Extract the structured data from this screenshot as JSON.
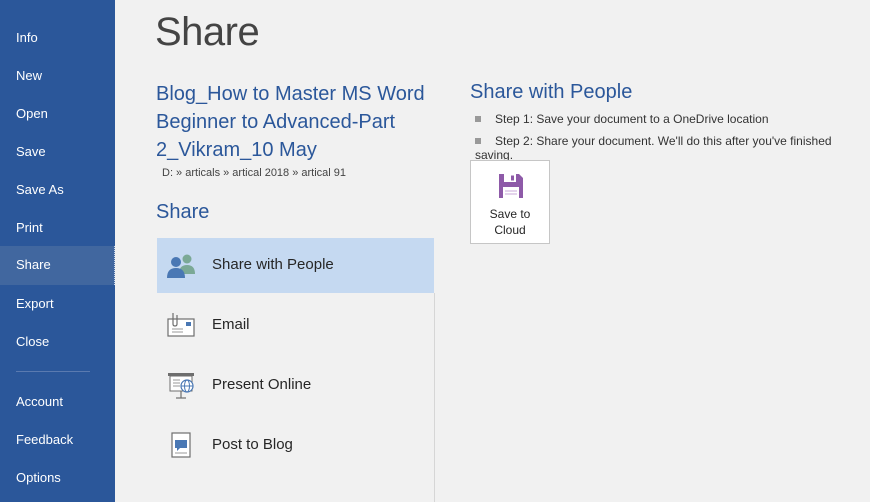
{
  "sidebar": {
    "items": [
      {
        "label": "Info"
      },
      {
        "label": "New"
      },
      {
        "label": "Open"
      },
      {
        "label": "Save"
      },
      {
        "label": "Save As"
      },
      {
        "label": "Print"
      },
      {
        "label": "Share",
        "active": true
      },
      {
        "label": "Export"
      },
      {
        "label": "Close"
      },
      {
        "label": "Account"
      },
      {
        "label": "Feedback"
      },
      {
        "label": "Options"
      }
    ]
  },
  "main": {
    "page_title": "Share",
    "doc_title": "Blog_How to Master MS Word Beginner to Advanced-Part 2_Vikram_10 May",
    "doc_path": "D: » articals » artical 2018 » artical 91",
    "share_heading": "Share",
    "share_options": [
      {
        "label": "Share with People",
        "icon": "people-icon",
        "active": true
      },
      {
        "label": "Email",
        "icon": "email-icon"
      },
      {
        "label": "Present Online",
        "icon": "present-online-icon"
      },
      {
        "label": "Post to Blog",
        "icon": "blog-icon"
      }
    ]
  },
  "right_panel": {
    "heading": "Share with People",
    "steps": [
      "Step 1: Save your document to a OneDrive location",
      "Step 2: Share your document. We'll do this after you've finished saving."
    ],
    "save_button_line1": "Save to",
    "save_button_line2": "Cloud",
    "save_button_icon": "floppy-disk-icon"
  },
  "colors": {
    "sidebar": "#2b579a",
    "accent": "#2b579a",
    "selected_item": "#c5d9f1",
    "save_icon": "#8e5aa8"
  }
}
